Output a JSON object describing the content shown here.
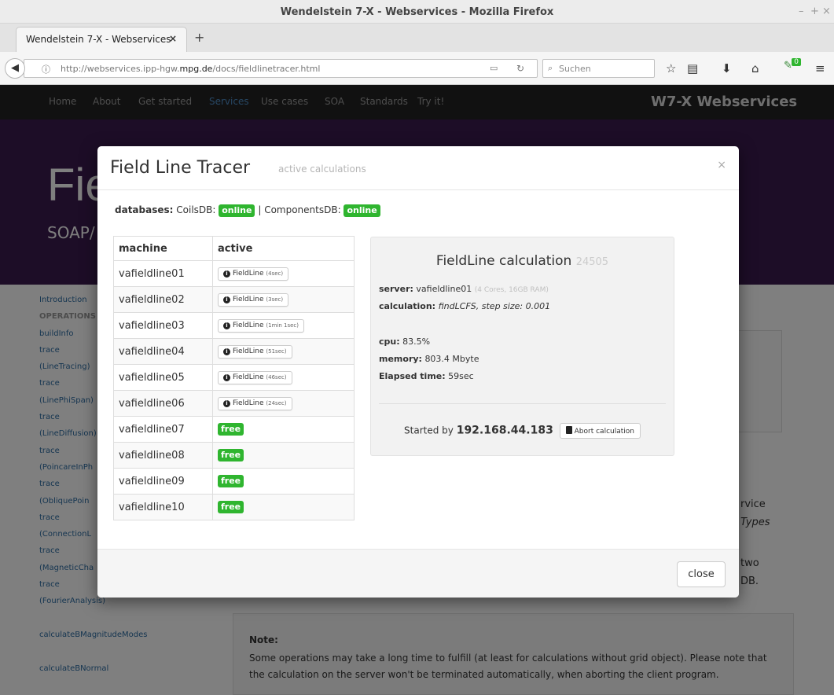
{
  "window": {
    "title": "Wendelstein 7-X - Webservices - Mozilla Firefox",
    "controls": [
      "–",
      "+",
      "×"
    ]
  },
  "tab": {
    "label": "Wendelstein 7-X - Webservices",
    "close": "×",
    "new_tab": "+"
  },
  "toolbar": {
    "url_prefix": "http://webservices.ipp-hgw.",
    "url_domain": "mpg.de",
    "url_path": "/docs/fieldlinetracer.html",
    "search_placeholder": "Suchen",
    "addon_badge": "0"
  },
  "site": {
    "nav": [
      "Home",
      "About",
      "Get started",
      "Services",
      "Use cases",
      "SOA",
      "Standards",
      "Try it!"
    ],
    "active_nav": "Services",
    "brand": "W7-X Webservices",
    "hero_title": "Fie",
    "hero_sub": "SOAP/",
    "side_links": [
      "Introduction",
      "OPERATIONS",
      "buildInfo",
      "trace",
      "(LineTracing)",
      "trace",
      "(LinePhiSpan)",
      "trace",
      "(LineDiffusion)",
      "trace",
      "(PoincareInPh",
      "trace",
      "(ObliquePoin",
      "trace",
      "(ConnectionL",
      "trace",
      "(MagneticCha",
      "trace",
      "(FourierAnalysis)",
      "",
      "calculateBMagnitudeModes",
      "",
      "calculateBNormal"
    ],
    "right_text_1": "rvice",
    "right_text_2": "Types",
    "right_text_3": "two",
    "right_text_4": "DB.",
    "note_title": "Note:",
    "note_text": "Some operations may take a long time to fulfill (at least for calculations without grid object). Please note that the calculation on the server won't be terminated automatically, when aborting the client program."
  },
  "modal": {
    "title": "Field Line Tracer",
    "subtitle": "active calculations",
    "close_x": "×",
    "databases_label": "databases:",
    "coilsdb_label": "CoilsDB:",
    "coilsdb_status": "online",
    "separator": "|",
    "componentsdb_label": "ComponentsDB:",
    "componentsdb_status": "online",
    "table": {
      "headers": [
        "machine",
        "active"
      ],
      "rows": [
        {
          "machine": "vafieldline01",
          "job": "FieldLine",
          "time": "(4sec)"
        },
        {
          "machine": "vafieldline02",
          "job": "FieldLine",
          "time": "(3sec)"
        },
        {
          "machine": "vafieldline03",
          "job": "FieldLine",
          "time": "(1min 1sec)"
        },
        {
          "machine": "vafieldline04",
          "job": "FieldLine",
          "time": "(51sec)"
        },
        {
          "machine": "vafieldline05",
          "job": "FieldLine",
          "time": "(46sec)"
        },
        {
          "machine": "vafieldline06",
          "job": "FieldLine",
          "time": "(24sec)"
        },
        {
          "machine": "vafieldline07",
          "free": "free"
        },
        {
          "machine": "vafieldline08",
          "free": "free"
        },
        {
          "machine": "vafieldline09",
          "free": "free"
        },
        {
          "machine": "vafieldline10",
          "free": "free"
        }
      ]
    },
    "calc": {
      "title": "FieldLine calculation",
      "id": "24505",
      "server_label": "server:",
      "server": "vafieldline01",
      "server_spec": "(4 Cores, 16GB RAM)",
      "calculation_label": "calculation:",
      "calculation": "findLCFS",
      "step_label": ", step size: 0.001",
      "cpu_label": "cpu:",
      "cpu": "83.5%",
      "memory_label": "memory:",
      "memory": "803.4 Mbyte",
      "elapsed_label": "Elapsed time:",
      "elapsed": "59sec",
      "started_by": "Started by",
      "ip": "192.168.44.183",
      "abort_label": "Abort calculation"
    },
    "close_button": "close"
  },
  "colors": {
    "label_green": "#2fb52f",
    "nav_bg": "#222222",
    "hero_bg": "#3a1a4e",
    "link": "#2d6ca2"
  }
}
